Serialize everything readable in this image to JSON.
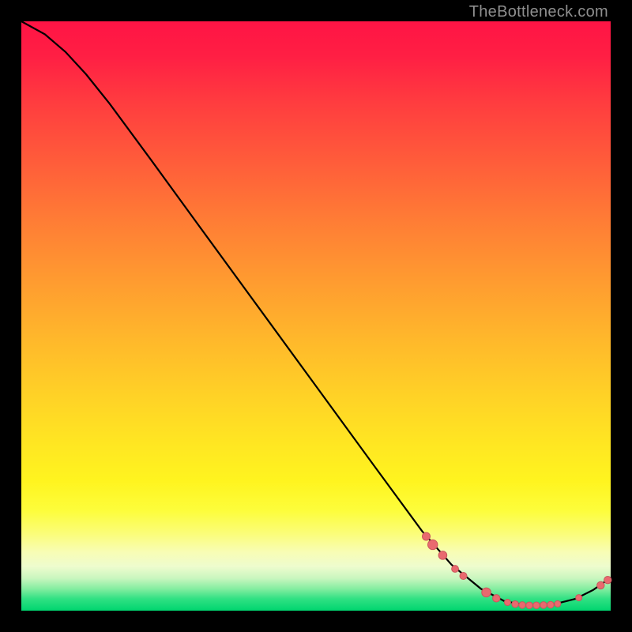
{
  "attribution": "TheBottleneck.com",
  "colors": {
    "dot_fill": "#e96a6f",
    "dot_stroke": "#c9575c",
    "curve": "#000000"
  },
  "chart_data": {
    "type": "line",
    "title": "",
    "xlabel": "",
    "ylabel": "",
    "xlim": [
      0,
      100
    ],
    "ylim": [
      0,
      100
    ],
    "grid": false,
    "legend": false,
    "note": "values estimated from pixel positions; axes are unlabeled in source image",
    "curve": [
      {
        "x": 0.0,
        "y": 100.0
      },
      {
        "x": 4.0,
        "y": 97.8
      },
      {
        "x": 7.5,
        "y": 94.8
      },
      {
        "x": 11.0,
        "y": 91.0
      },
      {
        "x": 15.0,
        "y": 86.0
      },
      {
        "x": 22.0,
        "y": 76.5
      },
      {
        "x": 30.0,
        "y": 65.5
      },
      {
        "x": 40.0,
        "y": 51.8
      },
      {
        "x": 50.0,
        "y": 38.1
      },
      {
        "x": 60.0,
        "y": 24.4
      },
      {
        "x": 68.0,
        "y": 13.5
      },
      {
        "x": 73.0,
        "y": 7.8
      },
      {
        "x": 78.0,
        "y": 3.7
      },
      {
        "x": 82.0,
        "y": 1.6
      },
      {
        "x": 86.0,
        "y": 0.9
      },
      {
        "x": 90.0,
        "y": 1.0
      },
      {
        "x": 94.0,
        "y": 2.0
      },
      {
        "x": 97.0,
        "y": 3.5
      },
      {
        "x": 100.0,
        "y": 5.6
      }
    ],
    "dots": [
      {
        "x": 68.7,
        "y": 12.6,
        "r": 5.0
      },
      {
        "x": 69.8,
        "y": 11.2,
        "r": 6.2
      },
      {
        "x": 71.5,
        "y": 9.4,
        "r": 5.3
      },
      {
        "x": 73.6,
        "y": 7.1,
        "r": 4.4
      },
      {
        "x": 75.0,
        "y": 5.9,
        "r": 4.5
      },
      {
        "x": 78.9,
        "y": 3.1,
        "r": 5.8
      },
      {
        "x": 80.6,
        "y": 2.1,
        "r": 4.7
      },
      {
        "x": 82.5,
        "y": 1.4,
        "r": 4.0
      },
      {
        "x": 83.8,
        "y": 1.1,
        "r": 4.3
      },
      {
        "x": 85.0,
        "y": 0.95,
        "r": 4.3
      },
      {
        "x": 86.2,
        "y": 0.9,
        "r": 4.3
      },
      {
        "x": 87.4,
        "y": 0.9,
        "r": 4.3
      },
      {
        "x": 88.6,
        "y": 0.95,
        "r": 4.3
      },
      {
        "x": 89.8,
        "y": 1.0,
        "r": 4.3
      },
      {
        "x": 91.0,
        "y": 1.15,
        "r": 4.0
      },
      {
        "x": 94.6,
        "y": 2.2,
        "r": 4.0
      },
      {
        "x": 98.3,
        "y": 4.3,
        "r": 4.7
      },
      {
        "x": 99.5,
        "y": 5.2,
        "r": 4.7
      }
    ]
  }
}
